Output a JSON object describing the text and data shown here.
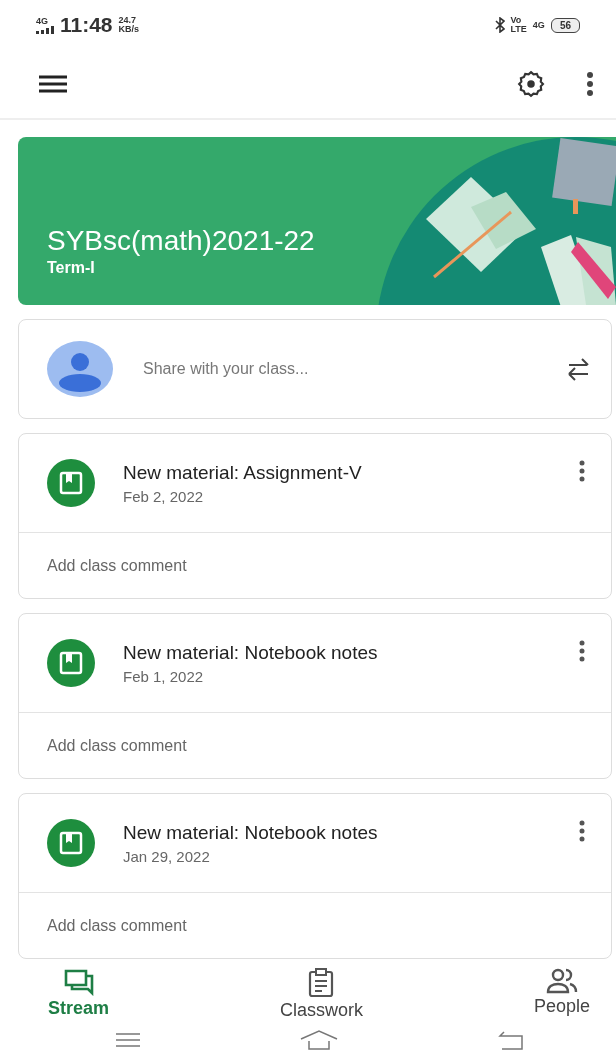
{
  "status_bar": {
    "network": "4G",
    "time": "11:48",
    "speed_value": "24.7",
    "speed_unit": "KB/s",
    "volte_top": "Vo",
    "volte_bottom": "LTE",
    "data_type": "4G",
    "battery": "56"
  },
  "banner": {
    "title": "SYBsc(math)2021-22",
    "subtitle": "Term-I"
  },
  "share": {
    "placeholder": "Share with your class..."
  },
  "posts": [
    {
      "title": "New material: Assignment-V",
      "date": "Feb 2, 2022",
      "comment_placeholder": "Add class comment"
    },
    {
      "title": "New material: Notebook notes",
      "date": "Feb 1, 2022",
      "comment_placeholder": "Add class comment"
    },
    {
      "title": "New material: Notebook notes",
      "date": "Jan 29, 2022",
      "comment_placeholder": "Add class comment"
    }
  ],
  "bottom_nav": [
    {
      "kind": "stream",
      "label": "Stream",
      "selected": true
    },
    {
      "kind": "classwork",
      "label": "Classwork",
      "selected": false
    },
    {
      "kind": "people",
      "label": "People",
      "selected": false
    }
  ]
}
